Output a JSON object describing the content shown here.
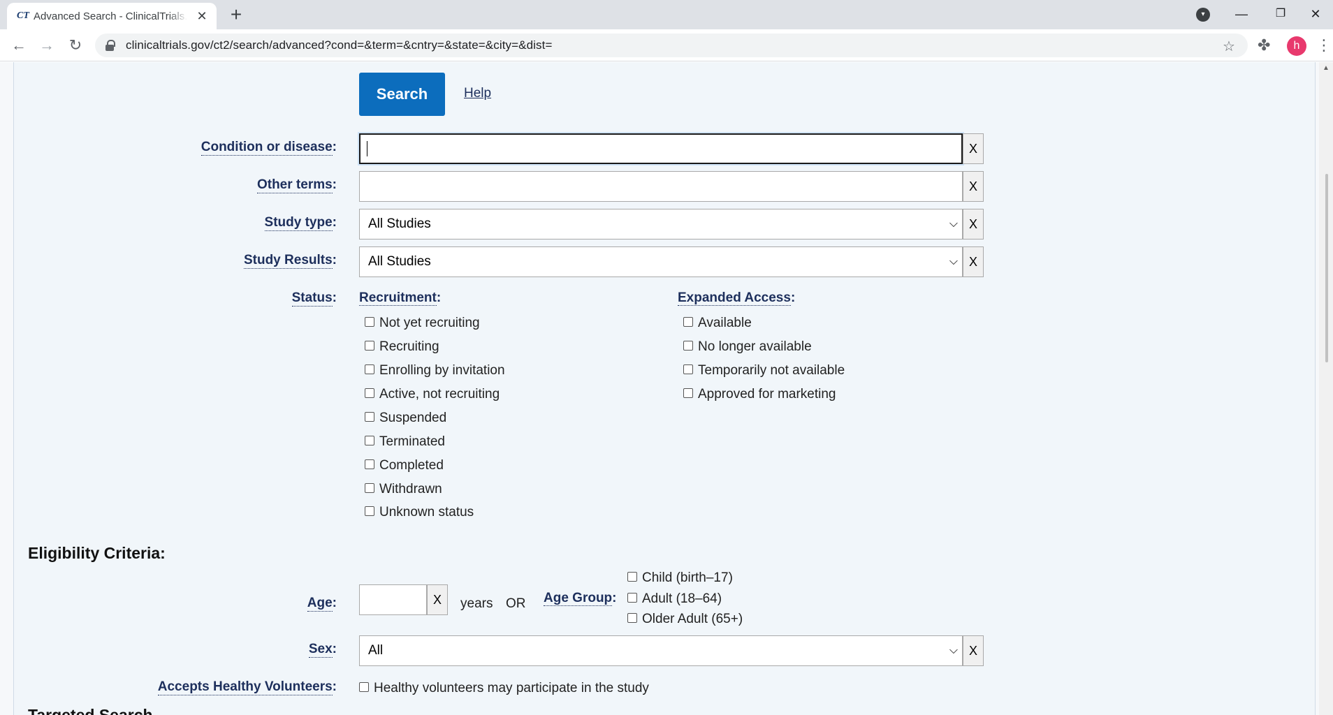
{
  "browser": {
    "tab_favicon": "CT",
    "tab_title": "Advanced Search - ClinicalTrials.gov",
    "url": "clinicaltrials.gov/ct2/search/advanced?cond=&term=&cntry=&state=&city=&dist=",
    "avatar_letter": "h"
  },
  "form": {
    "search_label": "Search",
    "help_label": "Help",
    "clear_label": "X",
    "condition": {
      "label": "Condition or disease",
      "value": ""
    },
    "other_terms": {
      "label": "Other terms",
      "value": ""
    },
    "study_type": {
      "label": "Study type",
      "value": "All Studies"
    },
    "study_results": {
      "label": "Study Results",
      "value": "All Studies"
    },
    "status": {
      "label": "Status",
      "recruitment_label": "Recruitment",
      "recruitment": [
        "Not yet recruiting",
        "Recruiting",
        "Enrolling by invitation",
        "Active, not recruiting",
        "Suspended",
        "Terminated",
        "Completed",
        "Withdrawn",
        "Unknown status"
      ],
      "expanded_label": "Expanded Access",
      "expanded": [
        "Available",
        "No longer available",
        "Temporarily not available",
        "Approved for marketing"
      ]
    },
    "eligibility": {
      "title": "Eligibility Criteria:",
      "age_label": "Age",
      "age_value": "",
      "years_text": "years",
      "or_text": "OR",
      "age_group_label": "Age Group",
      "age_groups": [
        "Child (birth–17)",
        "Adult (18–64)",
        "Older Adult (65+)"
      ],
      "sex_label": "Sex",
      "sex_value": "All",
      "healthy_label": "Accepts Healthy Volunteers",
      "healthy_option": "Healthy volunteers may participate in the study"
    },
    "next_section_title": "Targeted Search"
  }
}
